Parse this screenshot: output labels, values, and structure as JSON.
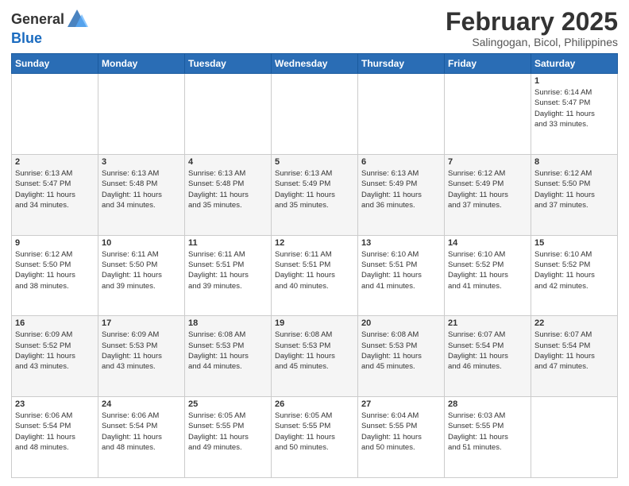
{
  "logo": {
    "general": "General",
    "blue": "Blue"
  },
  "title": "February 2025",
  "location": "Salingogan, Bicol, Philippines",
  "weekdays": [
    "Sunday",
    "Monday",
    "Tuesday",
    "Wednesday",
    "Thursday",
    "Friday",
    "Saturday"
  ],
  "weeks": [
    [
      {
        "day": "",
        "text": ""
      },
      {
        "day": "",
        "text": ""
      },
      {
        "day": "",
        "text": ""
      },
      {
        "day": "",
        "text": ""
      },
      {
        "day": "",
        "text": ""
      },
      {
        "day": "",
        "text": ""
      },
      {
        "day": "1",
        "text": "Sunrise: 6:14 AM\nSunset: 5:47 PM\nDaylight: 11 hours\nand 33 minutes."
      }
    ],
    [
      {
        "day": "2",
        "text": "Sunrise: 6:13 AM\nSunset: 5:47 PM\nDaylight: 11 hours\nand 34 minutes."
      },
      {
        "day": "3",
        "text": "Sunrise: 6:13 AM\nSunset: 5:48 PM\nDaylight: 11 hours\nand 34 minutes."
      },
      {
        "day": "4",
        "text": "Sunrise: 6:13 AM\nSunset: 5:48 PM\nDaylight: 11 hours\nand 35 minutes."
      },
      {
        "day": "5",
        "text": "Sunrise: 6:13 AM\nSunset: 5:49 PM\nDaylight: 11 hours\nand 35 minutes."
      },
      {
        "day": "6",
        "text": "Sunrise: 6:13 AM\nSunset: 5:49 PM\nDaylight: 11 hours\nand 36 minutes."
      },
      {
        "day": "7",
        "text": "Sunrise: 6:12 AM\nSunset: 5:49 PM\nDaylight: 11 hours\nand 37 minutes."
      },
      {
        "day": "8",
        "text": "Sunrise: 6:12 AM\nSunset: 5:50 PM\nDaylight: 11 hours\nand 37 minutes."
      }
    ],
    [
      {
        "day": "9",
        "text": "Sunrise: 6:12 AM\nSunset: 5:50 PM\nDaylight: 11 hours\nand 38 minutes."
      },
      {
        "day": "10",
        "text": "Sunrise: 6:11 AM\nSunset: 5:50 PM\nDaylight: 11 hours\nand 39 minutes."
      },
      {
        "day": "11",
        "text": "Sunrise: 6:11 AM\nSunset: 5:51 PM\nDaylight: 11 hours\nand 39 minutes."
      },
      {
        "day": "12",
        "text": "Sunrise: 6:11 AM\nSunset: 5:51 PM\nDaylight: 11 hours\nand 40 minutes."
      },
      {
        "day": "13",
        "text": "Sunrise: 6:10 AM\nSunset: 5:51 PM\nDaylight: 11 hours\nand 41 minutes."
      },
      {
        "day": "14",
        "text": "Sunrise: 6:10 AM\nSunset: 5:52 PM\nDaylight: 11 hours\nand 41 minutes."
      },
      {
        "day": "15",
        "text": "Sunrise: 6:10 AM\nSunset: 5:52 PM\nDaylight: 11 hours\nand 42 minutes."
      }
    ],
    [
      {
        "day": "16",
        "text": "Sunrise: 6:09 AM\nSunset: 5:52 PM\nDaylight: 11 hours\nand 43 minutes."
      },
      {
        "day": "17",
        "text": "Sunrise: 6:09 AM\nSunset: 5:53 PM\nDaylight: 11 hours\nand 43 minutes."
      },
      {
        "day": "18",
        "text": "Sunrise: 6:08 AM\nSunset: 5:53 PM\nDaylight: 11 hours\nand 44 minutes."
      },
      {
        "day": "19",
        "text": "Sunrise: 6:08 AM\nSunset: 5:53 PM\nDaylight: 11 hours\nand 45 minutes."
      },
      {
        "day": "20",
        "text": "Sunrise: 6:08 AM\nSunset: 5:53 PM\nDaylight: 11 hours\nand 45 minutes."
      },
      {
        "day": "21",
        "text": "Sunrise: 6:07 AM\nSunset: 5:54 PM\nDaylight: 11 hours\nand 46 minutes."
      },
      {
        "day": "22",
        "text": "Sunrise: 6:07 AM\nSunset: 5:54 PM\nDaylight: 11 hours\nand 47 minutes."
      }
    ],
    [
      {
        "day": "23",
        "text": "Sunrise: 6:06 AM\nSunset: 5:54 PM\nDaylight: 11 hours\nand 48 minutes."
      },
      {
        "day": "24",
        "text": "Sunrise: 6:06 AM\nSunset: 5:54 PM\nDaylight: 11 hours\nand 48 minutes."
      },
      {
        "day": "25",
        "text": "Sunrise: 6:05 AM\nSunset: 5:55 PM\nDaylight: 11 hours\nand 49 minutes."
      },
      {
        "day": "26",
        "text": "Sunrise: 6:05 AM\nSunset: 5:55 PM\nDaylight: 11 hours\nand 50 minutes."
      },
      {
        "day": "27",
        "text": "Sunrise: 6:04 AM\nSunset: 5:55 PM\nDaylight: 11 hours\nand 50 minutes."
      },
      {
        "day": "28",
        "text": "Sunrise: 6:03 AM\nSunset: 5:55 PM\nDaylight: 11 hours\nand 51 minutes."
      },
      {
        "day": "",
        "text": ""
      }
    ]
  ]
}
